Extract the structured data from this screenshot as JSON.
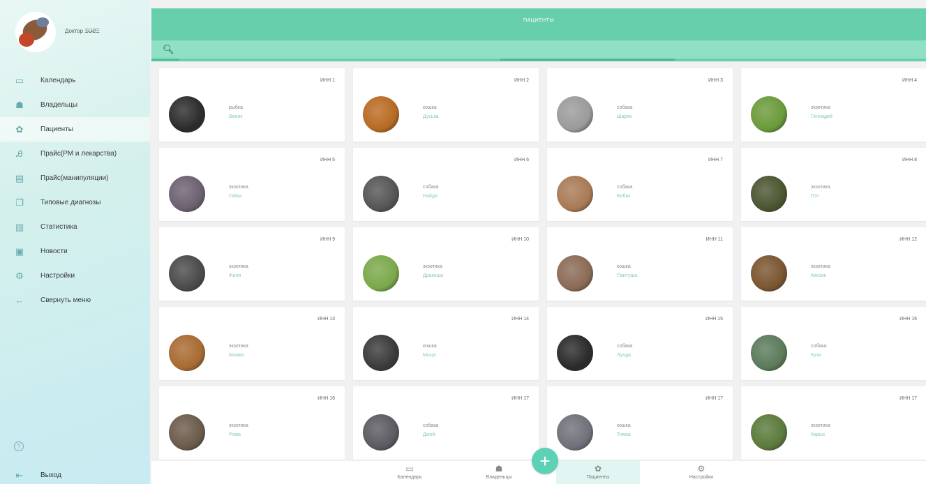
{
  "profile": {
    "name": "Доктор Ξ̶Ʋ̶ƧΞ"
  },
  "header": {
    "title": "ПАЦИЕНТЫ",
    "search_placeholder": ""
  },
  "sidebar": {
    "items": [
      {
        "label": "Календарь",
        "icon": "calendar-icon"
      },
      {
        "label": "Владельцы",
        "icon": "owners-icon"
      },
      {
        "label": "Пациенты",
        "icon": "paw-icon",
        "active": true
      },
      {
        "label": "Прайс(РМ и лекарства)",
        "icon": "flask-icon"
      },
      {
        "label": "Прайс(манипуляции)",
        "icon": "document-icon"
      },
      {
        "label": "Типовые диагнозы",
        "icon": "copy-icon"
      },
      {
        "label": "Статистика",
        "icon": "chart-icon"
      },
      {
        "label": "Новости",
        "icon": "news-icon"
      },
      {
        "label": "Настройки",
        "icon": "gear-icon"
      },
      {
        "label": "Свернуть меню",
        "icon": "arrow-left-icon"
      }
    ],
    "exit_label": "Выход"
  },
  "patients": [
    {
      "id": "ИНН 1",
      "species": "рыбка",
      "name": "Веник",
      "color": "#2b2b2b"
    },
    {
      "id": "ИНН 2",
      "species": "кошка",
      "name": "Дуська",
      "color": "#b86a22"
    },
    {
      "id": "ИНН 3",
      "species": "собака",
      "name": "Шарик",
      "color": "#9a9a9a"
    },
    {
      "id": "ИНН 4",
      "species": "экзотика",
      "name": "Геннадий",
      "color": "#6a9a3a"
    },
    {
      "id": "ИНН 5",
      "species": "экзотика",
      "name": "Гайка",
      "color": "#6b6070"
    },
    {
      "id": "ИНН 6",
      "species": "собака",
      "name": "Найда",
      "color": "#555555"
    },
    {
      "id": "ИНН 7",
      "species": "собака",
      "name": "Бобик",
      "color": "#a87a55"
    },
    {
      "id": "ИНН 8",
      "species": "экзотика",
      "name": "Пэт",
      "color": "#4a5530"
    },
    {
      "id": "ИНН 9",
      "species": "экзотика",
      "name": "Филя",
      "color": "#4a4a4a"
    },
    {
      "id": "ИНН 10",
      "species": "экзотика",
      "name": "Дракоша",
      "color": "#7aa84a"
    },
    {
      "id": "ИНН 11",
      "species": "кошка",
      "name": "Пантуша",
      "color": "#8a6a55"
    },
    {
      "id": "ИНН 12",
      "species": "экзотика",
      "name": "Кексик",
      "color": "#7a5530"
    },
    {
      "id": "ИНН 13",
      "species": "экзотика",
      "name": "Мамка",
      "color": "#a86a30"
    },
    {
      "id": "ИНН 14",
      "species": "кошка",
      "name": "Мыця",
      "color": "#3a3a3a"
    },
    {
      "id": "ИНН 15",
      "species": "собака",
      "name": "Лунда",
      "color": "#2a2a2a"
    },
    {
      "id": "ИНН 16",
      "species": "собака",
      "name": "Кузя",
      "color": "#5a7a5a"
    },
    {
      "id": "ИНН 16",
      "species": "экзотика",
      "name": "Рома",
      "color": "#6a5a4a"
    },
    {
      "id": "ИНН 17",
      "species": "собака",
      "name": "Джой",
      "color": "#5a5a60"
    },
    {
      "id": "ИНН 17",
      "species": "кошка",
      "name": "Тимка",
      "color": "#70707a"
    },
    {
      "id": "ИНН 17",
      "species": "экзотика",
      "name": "Карыс",
      "color": "#5a7a3a"
    }
  ],
  "bottom_tabs": [
    {
      "label": "Календарь",
      "icon": "calendar-icon"
    },
    {
      "label": "Владельцы",
      "icon": "owners-icon"
    },
    {
      "label": "Пациенты",
      "icon": "paw-icon",
      "active": true
    },
    {
      "label": "Настройки",
      "icon": "gear-icon"
    }
  ],
  "fab": {
    "label": "+"
  }
}
